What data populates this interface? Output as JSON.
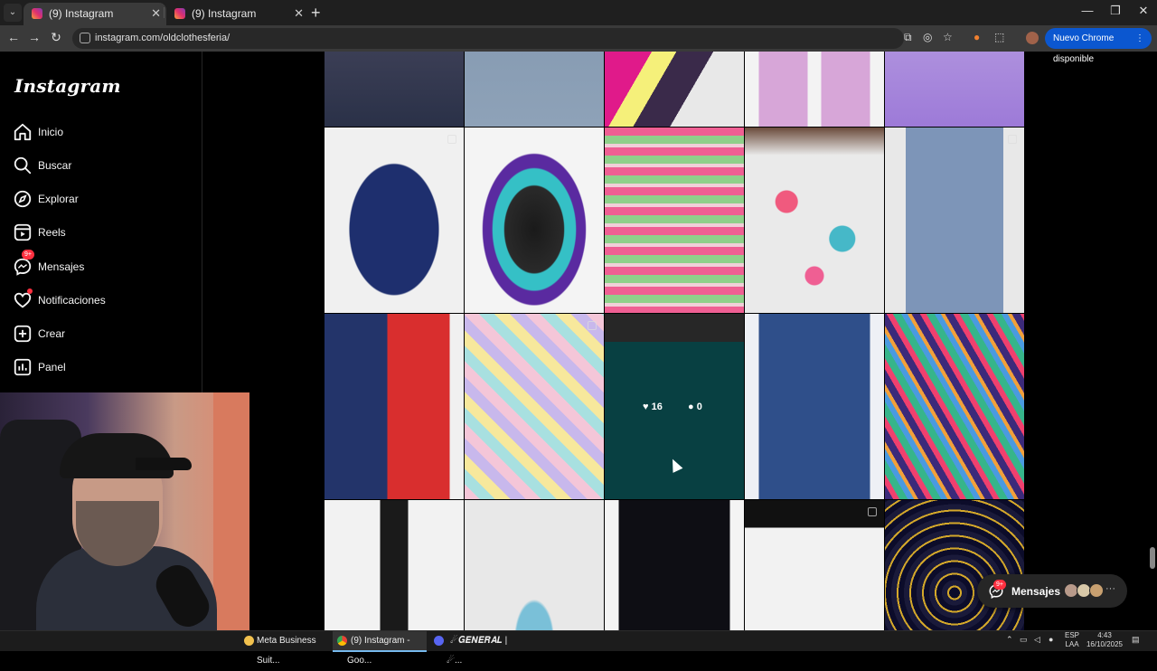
{
  "browser": {
    "tabs": [
      {
        "title": "(9) Instagram",
        "active": true
      },
      {
        "title": "(9) Instagram",
        "active": false
      }
    ],
    "url": "instagram.com/oldclothesferia/",
    "update_button": "Nuevo Chrome disponible"
  },
  "instagram": {
    "logo": "Instagram",
    "nav": [
      {
        "label": "Inicio",
        "icon": "home-icon"
      },
      {
        "label": "Buscar",
        "icon": "search-icon"
      },
      {
        "label": "Explorar",
        "icon": "compass-icon"
      },
      {
        "label": "Reels",
        "icon": "reels-icon"
      },
      {
        "label": "Mensajes",
        "icon": "messenger-icon",
        "badge": "9+"
      },
      {
        "label": "Notificaciones",
        "icon": "heart-icon",
        "dot": true
      },
      {
        "label": "Crear",
        "icon": "plus-square-icon"
      },
      {
        "label": "Panel",
        "icon": "chart-icon"
      }
    ],
    "hover_post": {
      "likes": "16",
      "comments": "0"
    },
    "messages_pill": {
      "label": "Mensajes",
      "badge": "9+"
    }
  },
  "taskbar": {
    "items": [
      {
        "label": "Meta Business Suit...",
        "color": "#f2c14e"
      },
      {
        "label": "(9) Instagram - Goo...",
        "color": "#ea4335",
        "active": true
      },
      {
        "label": "☄𝑮𝑬𝑵𝑬𝑹𝑨𝑳 | ☄...",
        "color": "#5865f2"
      }
    ],
    "lang_top": "ESP",
    "lang_bottom": "LAA",
    "time": "4:43",
    "date": "16/10/2025"
  },
  "colors": {
    "accent": "#0b57d0",
    "notification": "#ff3040",
    "background": "#000000"
  }
}
